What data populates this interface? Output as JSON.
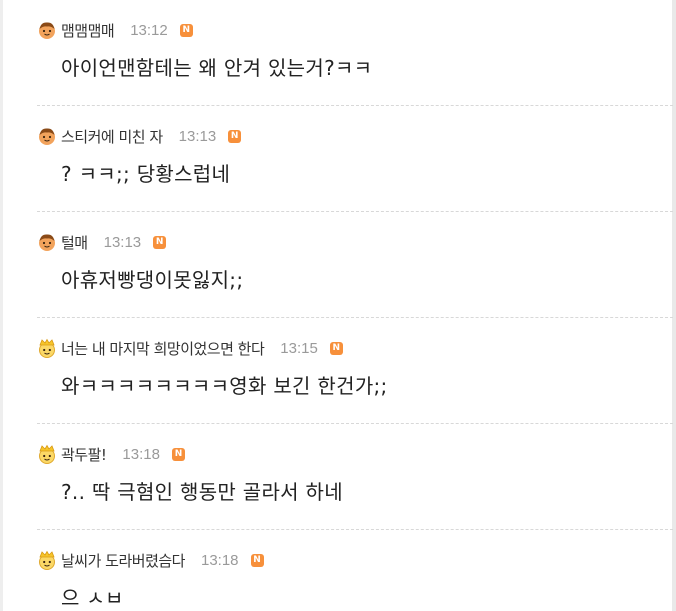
{
  "comments": [
    {
      "nickname": "맴맴맴매",
      "time": "13:12",
      "badge": "N",
      "text": "아이언맨함테는 왜 안겨 있는거?ㅋㅋ",
      "avatar": "boy-avatar-icon"
    },
    {
      "nickname": "스티커에 미친 자",
      "time": "13:13",
      "badge": "N",
      "text": "? ㅋㅋ;; 당황스럽네",
      "avatar": "boy-avatar-icon"
    },
    {
      "nickname": "털매",
      "time": "13:13",
      "badge": "N",
      "text": "아휴저빵댕이못잃지;;",
      "avatar": "boy-avatar-icon"
    },
    {
      "nickname": "너는 내 마지막 희망이었으면 한다",
      "time": "13:15",
      "badge": "N",
      "text": "와ㅋㅋㅋㅋㅋㅋㅋㅋ영화 보긴 한건가;;",
      "avatar": "crown-avatar-icon"
    },
    {
      "nickname": "곽두팔!",
      "time": "13:18",
      "badge": "N",
      "text": "?.. 딱 극혐인 행동만 골라서 하네",
      "avatar": "crown-avatar-icon"
    },
    {
      "nickname": "날씨가 도라버렸슴다",
      "time": "13:18",
      "badge": "N",
      "text": "으 ㅅㅂ",
      "avatar": "crown-avatar-icon"
    }
  ],
  "colors": {
    "badge": "#f7903b",
    "time": "#9a9a9a",
    "divider": "#d8d8d8"
  }
}
